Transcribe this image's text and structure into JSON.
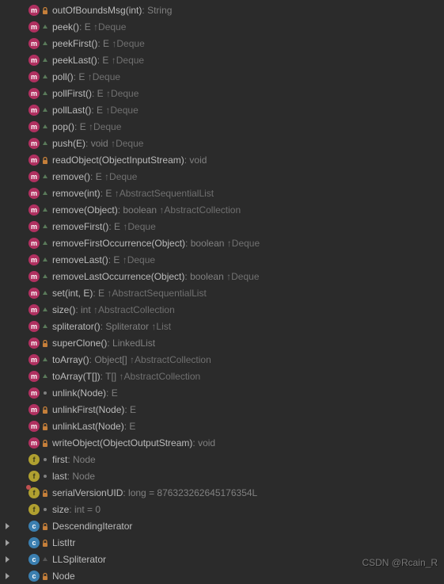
{
  "members": [
    {
      "kind": "m",
      "mod": "lock",
      "name": "outOfBoundsMsg(int)",
      "ret": "String",
      "inh": null
    },
    {
      "kind": "m",
      "mod": "override",
      "name": "peek()",
      "ret": "E",
      "inh": "Deque"
    },
    {
      "kind": "m",
      "mod": "override",
      "name": "peekFirst()",
      "ret": "E",
      "inh": "Deque"
    },
    {
      "kind": "m",
      "mod": "override",
      "name": "peekLast()",
      "ret": "E",
      "inh": "Deque"
    },
    {
      "kind": "m",
      "mod": "override",
      "name": "poll()",
      "ret": "E",
      "inh": "Deque"
    },
    {
      "kind": "m",
      "mod": "override",
      "name": "pollFirst()",
      "ret": "E",
      "inh": "Deque"
    },
    {
      "kind": "m",
      "mod": "override",
      "name": "pollLast()",
      "ret": "E",
      "inh": "Deque"
    },
    {
      "kind": "m",
      "mod": "override",
      "name": "pop()",
      "ret": "E",
      "inh": "Deque"
    },
    {
      "kind": "m",
      "mod": "override",
      "name": "push(E)",
      "ret": "void",
      "inh": "Deque"
    },
    {
      "kind": "m",
      "mod": "lock",
      "name": "readObject(ObjectInputStream)",
      "ret": "void",
      "inh": null
    },
    {
      "kind": "m",
      "mod": "override",
      "name": "remove()",
      "ret": "E",
      "inh": "Deque"
    },
    {
      "kind": "m",
      "mod": "override",
      "name": "remove(int)",
      "ret": "E",
      "inh": "AbstractSequentialList"
    },
    {
      "kind": "m",
      "mod": "override",
      "name": "remove(Object)",
      "ret": "boolean",
      "inh": "AbstractCollection"
    },
    {
      "kind": "m",
      "mod": "override",
      "name": "removeFirst()",
      "ret": "E",
      "inh": "Deque"
    },
    {
      "kind": "m",
      "mod": "override",
      "name": "removeFirstOccurrence(Object)",
      "ret": "boolean",
      "inh": "Deque"
    },
    {
      "kind": "m",
      "mod": "override",
      "name": "removeLast()",
      "ret": "E",
      "inh": "Deque"
    },
    {
      "kind": "m",
      "mod": "override",
      "name": "removeLastOccurrence(Object)",
      "ret": "boolean",
      "inh": "Deque"
    },
    {
      "kind": "m",
      "mod": "override",
      "name": "set(int, E)",
      "ret": "E",
      "inh": "AbstractSequentialList"
    },
    {
      "kind": "m",
      "mod": "override",
      "name": "size()",
      "ret": "int",
      "inh": "AbstractCollection"
    },
    {
      "kind": "m",
      "mod": "override",
      "name": "spliterator()",
      "ret": "Spliterator<E>",
      "inh": "List"
    },
    {
      "kind": "m",
      "mod": "lock",
      "name": "superClone()",
      "ret": "LinkedList<E>",
      "inh": null
    },
    {
      "kind": "m",
      "mod": "override",
      "name": "toArray()",
      "ret": "Object[]",
      "inh": "AbstractCollection"
    },
    {
      "kind": "m",
      "mod": "override",
      "name": "toArray(T[])",
      "ret": "T[]",
      "inh": "AbstractCollection"
    },
    {
      "kind": "m",
      "mod": "pin",
      "name": "unlink(Node<E>)",
      "ret": "E",
      "inh": null
    },
    {
      "kind": "m",
      "mod": "lock",
      "name": "unlinkFirst(Node<E>)",
      "ret": "E",
      "inh": null
    },
    {
      "kind": "m",
      "mod": "lock",
      "name": "unlinkLast(Node<E>)",
      "ret": "E",
      "inh": null
    },
    {
      "kind": "m",
      "mod": "lock",
      "name": "writeObject(ObjectOutputStream)",
      "ret": "void",
      "inh": null
    },
    {
      "kind": "f",
      "mod": "pin",
      "name": "first",
      "ret": "Node<E>",
      "inh": null
    },
    {
      "kind": "f",
      "mod": "pin",
      "name": "last",
      "ret": "Node<E>",
      "inh": null
    },
    {
      "kind": "sf",
      "mod": "lock",
      "name": "serialVersionUID",
      "ret": "long = 876323262645176354L",
      "inh": null
    },
    {
      "kind": "f",
      "mod": "pin",
      "name": "size",
      "ret": "int = 0",
      "inh": null
    }
  ],
  "classes": [
    {
      "mod": "lock",
      "name": "DescendingIterator"
    },
    {
      "mod": "lock",
      "name": "ListItr"
    },
    {
      "mod": "dim",
      "name": "LLSpliterator"
    },
    {
      "mod": "lock",
      "name": "Node"
    }
  ],
  "watermark": "CSDN @Rcain_R",
  "glyphs": {
    "m": "m",
    "f": "f",
    "c": "c",
    "sf": "f"
  }
}
